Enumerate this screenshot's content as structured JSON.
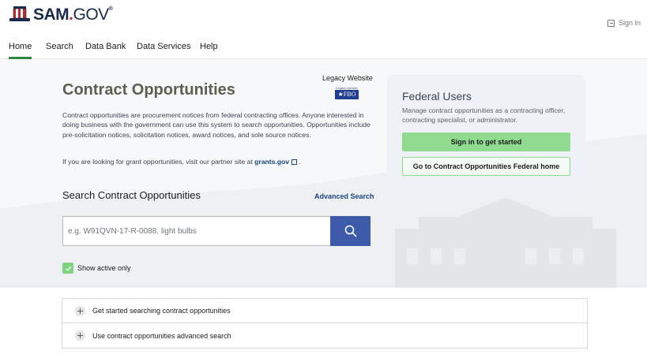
{
  "header": {
    "logo_text": "SAM.GOV",
    "logo_main": "SAM",
    "logo_dot": ".",
    "logo_gov": "GOV",
    "logo_reg": "®",
    "signin_label": "Sign In",
    "signin_icon": "sign-in-icon"
  },
  "nav": {
    "items": [
      "Home",
      "Search",
      "Data Bank",
      "Data Services",
      "Help"
    ],
    "active": "Home"
  },
  "main": {
    "title": "Contract Opportunities",
    "legacy_label": "Legacy Website",
    "fbo_caption": "Legacy website",
    "fbo_badge": "★FBO",
    "description": "Contract opportunities are procurement notices from federal contracting offices. Anyone interested in doing business with the government can use this system to search opportunities. Opportunities include pre-solicitation notices, solicitation notices, award notices, and sole source notices.",
    "grants_prefix": "If you are looking for grant opportunities, visit our partner site at ",
    "grants_link": "grants.gov",
    "grants_suffix": " .",
    "search_heading": "Search Contract Opportunities",
    "advanced_search": "Advanced Search",
    "search_placeholder": "e.g. W91QVN-17-R-0088, light bulbs",
    "show_active_label": "Show active only",
    "show_active_checked": true
  },
  "federal_card": {
    "title": "Federal Users",
    "description": "Manage contract opportunities as a contracting officer, contracting specialist, or administrator.",
    "primary_button": "Sign in to get started",
    "secondary_button": "Go to Contract Opportunities Federal home"
  },
  "accordion": [
    {
      "label": "Get started searching contract opportunities"
    },
    {
      "label": "Use contract opportunities advanced search"
    }
  ],
  "colors": {
    "accent_green": "#2e8540",
    "search_button": "#3d5ba9",
    "link_blue": "#1a4480",
    "card_button_green": "#8fdc8f"
  }
}
